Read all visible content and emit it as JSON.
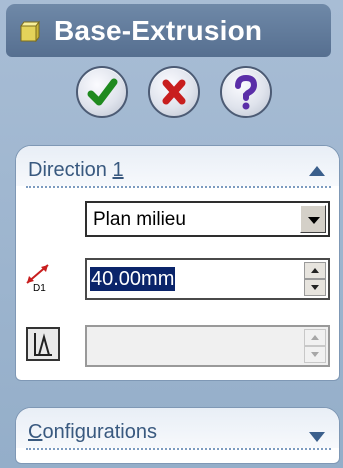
{
  "title": {
    "text": "Base-Extrusion",
    "icon": "extrusion-feature-icon"
  },
  "actions": [
    {
      "name": "ok-button",
      "icon": "checkmark-icon",
      "color": "#1f8a1f"
    },
    {
      "name": "cancel-button",
      "icon": "x-icon",
      "color": "#c81e1e"
    },
    {
      "name": "help-button",
      "icon": "question-icon",
      "color": "#5a2ea8"
    }
  ],
  "direction1": {
    "label_prefix": "Direction ",
    "label_key": "1",
    "end_condition": "Plan milieu",
    "depth_value": "40.00mm",
    "draft_value": ""
  },
  "configurations": {
    "label_prefix": "",
    "label_key": "C",
    "label_rest": "onfigurations"
  },
  "colors": {
    "accent": "#566f90",
    "panel_text": "#39597f",
    "selection": "#0a246a"
  }
}
